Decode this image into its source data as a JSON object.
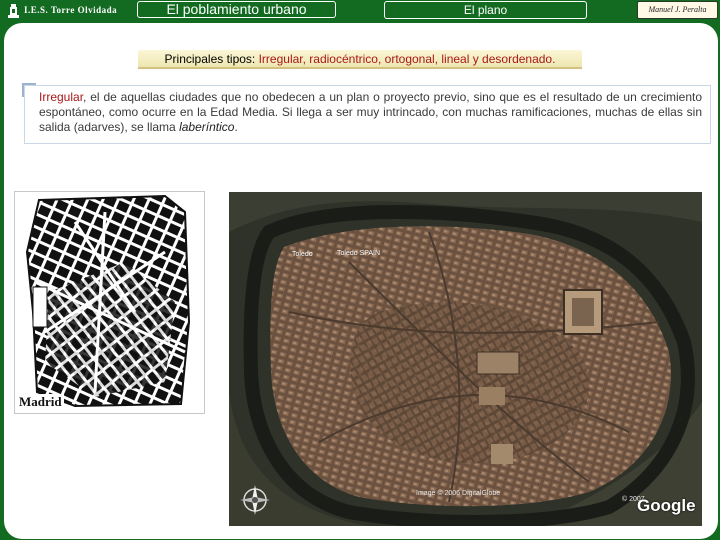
{
  "header": {
    "school_name": "I.E.S. Torre Olvidada",
    "title": "El poblamiento urbano",
    "section": "El plano",
    "author": "Manuel J. Peralta"
  },
  "subtitle": {
    "prefix": "Principales tipos: ",
    "types": "Irregular, radiocéntrico, ortogonal, lineal y desordenado."
  },
  "description": {
    "keyword": "Irregular",
    "text_before": ", el de aquellas ciudades que no obedecen a un plan o proyecto previo, sino que es el resultado de un crecimiento espontáneo, como ocurre en la Edad Media. Si llega a ser muy intrincado, con muchas ramificaciones, muchas de ellas sin salida (adarves), se llama ",
    "italic_term": "laberíntico",
    "text_after": "."
  },
  "madrid_map": {
    "label": "Madrid"
  },
  "satellite": {
    "label_city": "Toledo",
    "label_place": "Toledo SPAIN",
    "copyright": "Image © 2006 DigitalGlobe",
    "google_copyright": "© 2007",
    "google_logo": "Google"
  },
  "colors": {
    "background": "#136b22",
    "accent_red": "#a81818"
  }
}
